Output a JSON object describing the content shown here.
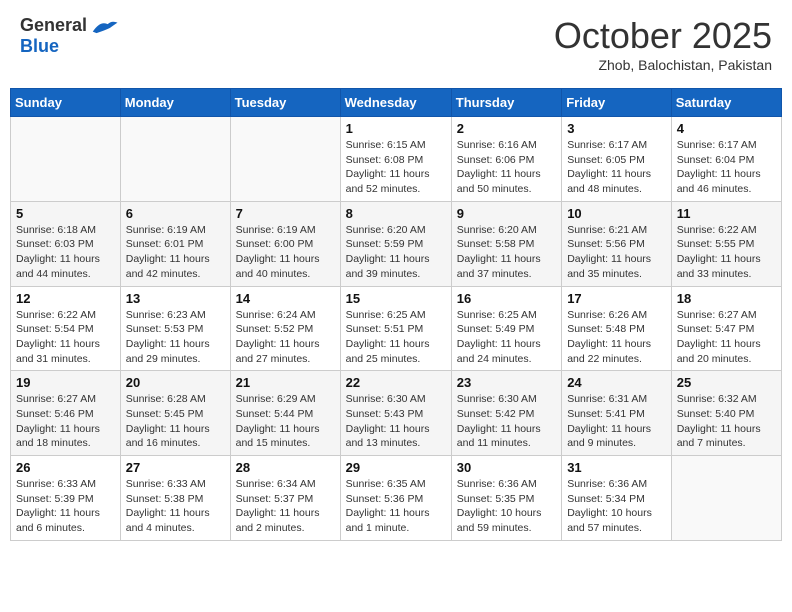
{
  "header": {
    "logo_general": "General",
    "logo_blue": "Blue",
    "month_title": "October 2025",
    "location": "Zhob, Balochistan, Pakistan"
  },
  "weekdays": [
    "Sunday",
    "Monday",
    "Tuesday",
    "Wednesday",
    "Thursday",
    "Friday",
    "Saturday"
  ],
  "weeks": [
    [
      {
        "day": "",
        "info": ""
      },
      {
        "day": "",
        "info": ""
      },
      {
        "day": "",
        "info": ""
      },
      {
        "day": "1",
        "info": "Sunrise: 6:15 AM\nSunset: 6:08 PM\nDaylight: 11 hours\nand 52 minutes."
      },
      {
        "day": "2",
        "info": "Sunrise: 6:16 AM\nSunset: 6:06 PM\nDaylight: 11 hours\nand 50 minutes."
      },
      {
        "day": "3",
        "info": "Sunrise: 6:17 AM\nSunset: 6:05 PM\nDaylight: 11 hours\nand 48 minutes."
      },
      {
        "day": "4",
        "info": "Sunrise: 6:17 AM\nSunset: 6:04 PM\nDaylight: 11 hours\nand 46 minutes."
      }
    ],
    [
      {
        "day": "5",
        "info": "Sunrise: 6:18 AM\nSunset: 6:03 PM\nDaylight: 11 hours\nand 44 minutes."
      },
      {
        "day": "6",
        "info": "Sunrise: 6:19 AM\nSunset: 6:01 PM\nDaylight: 11 hours\nand 42 minutes."
      },
      {
        "day": "7",
        "info": "Sunrise: 6:19 AM\nSunset: 6:00 PM\nDaylight: 11 hours\nand 40 minutes."
      },
      {
        "day": "8",
        "info": "Sunrise: 6:20 AM\nSunset: 5:59 PM\nDaylight: 11 hours\nand 39 minutes."
      },
      {
        "day": "9",
        "info": "Sunrise: 6:20 AM\nSunset: 5:58 PM\nDaylight: 11 hours\nand 37 minutes."
      },
      {
        "day": "10",
        "info": "Sunrise: 6:21 AM\nSunset: 5:56 PM\nDaylight: 11 hours\nand 35 minutes."
      },
      {
        "day": "11",
        "info": "Sunrise: 6:22 AM\nSunset: 5:55 PM\nDaylight: 11 hours\nand 33 minutes."
      }
    ],
    [
      {
        "day": "12",
        "info": "Sunrise: 6:22 AM\nSunset: 5:54 PM\nDaylight: 11 hours\nand 31 minutes."
      },
      {
        "day": "13",
        "info": "Sunrise: 6:23 AM\nSunset: 5:53 PM\nDaylight: 11 hours\nand 29 minutes."
      },
      {
        "day": "14",
        "info": "Sunrise: 6:24 AM\nSunset: 5:52 PM\nDaylight: 11 hours\nand 27 minutes."
      },
      {
        "day": "15",
        "info": "Sunrise: 6:25 AM\nSunset: 5:51 PM\nDaylight: 11 hours\nand 25 minutes."
      },
      {
        "day": "16",
        "info": "Sunrise: 6:25 AM\nSunset: 5:49 PM\nDaylight: 11 hours\nand 24 minutes."
      },
      {
        "day": "17",
        "info": "Sunrise: 6:26 AM\nSunset: 5:48 PM\nDaylight: 11 hours\nand 22 minutes."
      },
      {
        "day": "18",
        "info": "Sunrise: 6:27 AM\nSunset: 5:47 PM\nDaylight: 11 hours\nand 20 minutes."
      }
    ],
    [
      {
        "day": "19",
        "info": "Sunrise: 6:27 AM\nSunset: 5:46 PM\nDaylight: 11 hours\nand 18 minutes."
      },
      {
        "day": "20",
        "info": "Sunrise: 6:28 AM\nSunset: 5:45 PM\nDaylight: 11 hours\nand 16 minutes."
      },
      {
        "day": "21",
        "info": "Sunrise: 6:29 AM\nSunset: 5:44 PM\nDaylight: 11 hours\nand 15 minutes."
      },
      {
        "day": "22",
        "info": "Sunrise: 6:30 AM\nSunset: 5:43 PM\nDaylight: 11 hours\nand 13 minutes."
      },
      {
        "day": "23",
        "info": "Sunrise: 6:30 AM\nSunset: 5:42 PM\nDaylight: 11 hours\nand 11 minutes."
      },
      {
        "day": "24",
        "info": "Sunrise: 6:31 AM\nSunset: 5:41 PM\nDaylight: 11 hours\nand 9 minutes."
      },
      {
        "day": "25",
        "info": "Sunrise: 6:32 AM\nSunset: 5:40 PM\nDaylight: 11 hours\nand 7 minutes."
      }
    ],
    [
      {
        "day": "26",
        "info": "Sunrise: 6:33 AM\nSunset: 5:39 PM\nDaylight: 11 hours\nand 6 minutes."
      },
      {
        "day": "27",
        "info": "Sunrise: 6:33 AM\nSunset: 5:38 PM\nDaylight: 11 hours\nand 4 minutes."
      },
      {
        "day": "28",
        "info": "Sunrise: 6:34 AM\nSunset: 5:37 PM\nDaylight: 11 hours\nand 2 minutes."
      },
      {
        "day": "29",
        "info": "Sunrise: 6:35 AM\nSunset: 5:36 PM\nDaylight: 11 hours\nand 1 minute."
      },
      {
        "day": "30",
        "info": "Sunrise: 6:36 AM\nSunset: 5:35 PM\nDaylight: 10 hours\nand 59 minutes."
      },
      {
        "day": "31",
        "info": "Sunrise: 6:36 AM\nSunset: 5:34 PM\nDaylight: 10 hours\nand 57 minutes."
      },
      {
        "day": "",
        "info": ""
      }
    ]
  ]
}
